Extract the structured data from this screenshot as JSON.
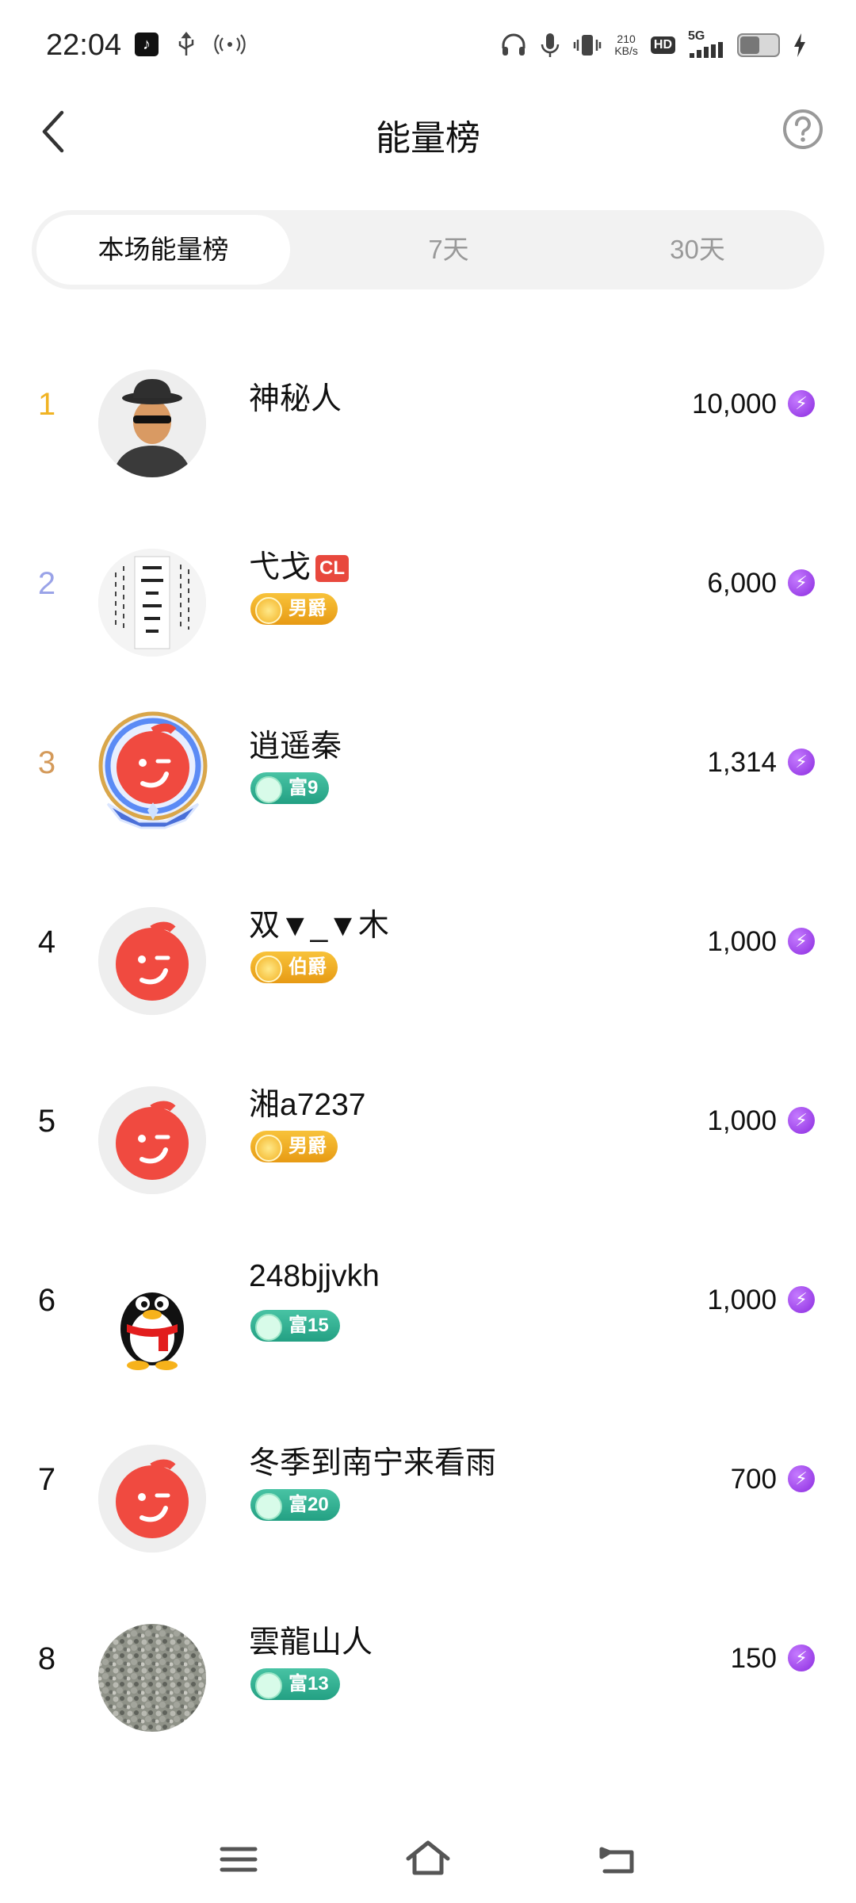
{
  "status_bar": {
    "time": "22:04",
    "net_speed_value": "210",
    "net_speed_unit": "KB/s",
    "hd": "HD",
    "network": "5G",
    "icons": [
      "tiktok-icon",
      "usb-icon",
      "hotspot-icon",
      "headphones-icon",
      "mic-icon",
      "vibrate-icon",
      "signal-icon",
      "battery-icon",
      "charging-icon"
    ]
  },
  "header": {
    "title": "能量榜"
  },
  "tabs": [
    {
      "label": "本场能量榜",
      "active": true
    },
    {
      "label": "7天",
      "active": false
    },
    {
      "label": "30天",
      "active": false
    }
  ],
  "ranking": [
    {
      "rank": "1",
      "rank_color": "#f0b323",
      "name": "神秘人",
      "score": "10,000",
      "badge": null,
      "avatar": "mystery-man"
    },
    {
      "rank": "2",
      "rank_color": "#9aa3e8",
      "name": "弋戈",
      "tag": "CL",
      "score": "6,000",
      "badge": {
        "type": "gold",
        "label": "男爵"
      },
      "avatar": "calligraphy"
    },
    {
      "rank": "3",
      "rank_color": "#d49a5a",
      "name": "逍遥秦",
      "score": "1,314",
      "badge": {
        "type": "green",
        "label": "富9"
      },
      "avatar": "default-framed"
    },
    {
      "rank": "4",
      "rank_color": "#111111",
      "name": "双▼_▼木",
      "score": "1,000",
      "badge": {
        "type": "gold",
        "label": "伯爵"
      },
      "avatar": "default"
    },
    {
      "rank": "5",
      "rank_color": "#111111",
      "name": "湘a7237",
      "score": "1,000",
      "badge": {
        "type": "gold",
        "label": "男爵"
      },
      "avatar": "default"
    },
    {
      "rank": "6",
      "rank_color": "#111111",
      "name": "248bjjvkh",
      "score": "1,000",
      "badge": {
        "type": "green",
        "label": "富15"
      },
      "avatar": "penguin"
    },
    {
      "rank": "7",
      "rank_color": "#111111",
      "name": "冬季到南宁来看雨",
      "score": "700",
      "badge": {
        "type": "green",
        "label": "富20"
      },
      "avatar": "default"
    },
    {
      "rank": "8",
      "rank_color": "#111111",
      "name": "雲龍山人",
      "score": "150",
      "badge": {
        "type": "green",
        "label": "富13"
      },
      "avatar": "gravel"
    }
  ],
  "colors": {
    "accent_purple": "#8b2bdf",
    "gold_badge": "#f0b323",
    "green_badge": "#2aa88a"
  },
  "nav_bar": {
    "icons": [
      "menu-icon",
      "home-icon",
      "back-icon"
    ]
  }
}
